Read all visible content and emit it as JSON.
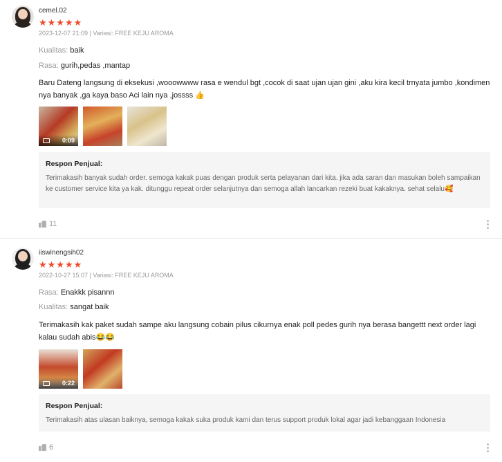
{
  "reviews": [
    {
      "username": "cemel.02",
      "stars": "★★★★★",
      "date": "2023-12-07 21:09",
      "variant_label": "Variasi: FREE KEJU AROMA",
      "attributes": [
        {
          "key": "Kualitas:",
          "value": "baik"
        },
        {
          "key": "Rasa:",
          "value": "gurih,pedas ,mantap"
        }
      ],
      "text": "Baru Dateng langsung di eksekusi ,wooowwww rasa e wendul bgt ,cocok di saat ujan ujan gini ,aku kira kecil trnyata jumbo ,kondimen nya banyak ,ga kaya baso Aci lain nya ,jossss 👍",
      "media": [
        {
          "type": "video",
          "duration": "0:09"
        },
        {
          "type": "image"
        },
        {
          "type": "image"
        }
      ],
      "reply": {
        "title": "Respon Penjual:",
        "text": "Terimakasih banyak sudah order. semoga kakak puas dengan produk serta pelayanan dari kita. jika ada saran dan masukan boleh sampaikan ke customer service kita ya kak. ditunggu repeat order selanjutnya dan semoga allah lancarkan rezeki buat kakaknya. sehat selalu🥰"
      },
      "likes": "11"
    },
    {
      "username": "iiswinengsih02",
      "stars": "★★★★★",
      "date": "2022-10-27 15:07",
      "variant_label": "Variasi: FREE KEJU AROMA",
      "attributes": [
        {
          "key": "Rasa:",
          "value": "Enakkk pisannn"
        },
        {
          "key": "Kualitas:",
          "value": "sangat baik"
        }
      ],
      "text": "Terimakasih kak paket sudah sampe aku langsung cobain pilus cikurnya enak poll pedes gurih nya berasa bangettt next order lagi kalau sudah abis😂😂",
      "media": [
        {
          "type": "video",
          "duration": "0:22"
        },
        {
          "type": "image"
        }
      ],
      "reply": {
        "title": "Respon Penjual:",
        "text": "Terimakasih atas ulasan baiknya, semoga kakak suka produk kami dan terus support produk lokal agar jadi kebanggaan Indonesia"
      },
      "likes": "6"
    }
  ],
  "colors": {
    "star": "#ee4d2d",
    "meta": "#9a9a9a",
    "reply_bg": "#f5f5f5"
  },
  "icons": {
    "like": "thumb-up-icon",
    "more": "more-vertical-icon",
    "video": "video-camera-icon"
  }
}
